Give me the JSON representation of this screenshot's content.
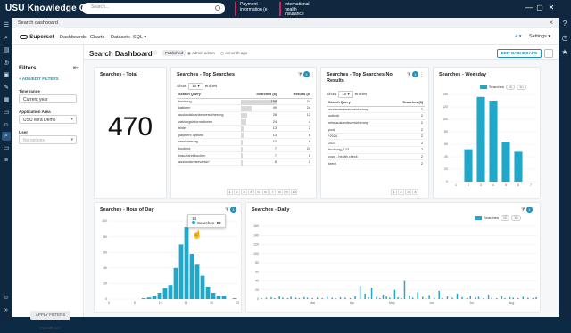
{
  "topbar": {
    "logo": "USU Knowledge Center",
    "search_placeholder": "Search...",
    "tabs": [
      {
        "label": "Payment information (e"
      },
      {
        "label": "International health insurance"
      }
    ]
  },
  "window": {
    "title": "Search dashboard"
  },
  "appnav": {
    "brand": "Superset",
    "items": [
      "Dashboards",
      "Charts",
      "Datasets",
      "SQL"
    ],
    "right_plus": "+",
    "settings": "Settings"
  },
  "dashboard": {
    "title": "Search Dashboard",
    "status": "Published",
    "author": "admin admin",
    "modified": "a month ago",
    "edit_label": "EDIT DASHBOARD",
    "more_label": "..."
  },
  "filters": {
    "heading": "Filters",
    "add_label": "+ ADD/EDIT FILTERS",
    "time_range_label": "Time range",
    "time_range_value": "Current year",
    "app_area_label": "Application Area",
    "app_area_value": "USU Mira Demo",
    "user_label": "User",
    "user_placeholder": "No options",
    "apply_label": "APPLY FILTERS",
    "clear_label": "CLEAR ALL"
  },
  "cards": {
    "total": {
      "title": "Searches - Total",
      "value": "470"
    },
    "top": {
      "title": "Searches - Top Searches",
      "show": "Show",
      "entries": "entries",
      "page_size": "10",
      "columns": [
        "Search Query",
        "Searches (8)",
        "Results (8)"
      ],
      "rows": [
        {
          "q": "buchung",
          "s": "158",
          "r": "24",
          "pct": 1.0
        },
        {
          "q": "kabinen",
          "s": "49",
          "r": "24",
          "pct": 0.31
        },
        {
          "q": "auslandskrankenversicherung",
          "s": "28",
          "r": "12",
          "pct": 0.18
        },
        {
          "q": "zahlungsinformationen",
          "s": "24",
          "r": "4",
          "pct": 0.15
        },
        {
          "q": "bilder",
          "s": "13",
          "r": "2",
          "pct": 0.08
        },
        {
          "q": "payment options",
          "s": "13",
          "r": "6",
          "pct": 0.08
        },
        {
          "q": "versicherung",
          "s": "10",
          "r": "8",
          "pct": 0.06
        },
        {
          "q": "booking",
          "s": "7",
          "r": "24",
          "pct": 0.045
        },
        {
          "q": "krauzfahrt buchen",
          "s": "7",
          "r": "8",
          "pct": 0.045
        },
        {
          "q": "auslandsreiseversic*",
          "s": "6",
          "r": "2",
          "pct": 0.04
        }
      ],
      "pages": [
        "1",
        "2",
        "3",
        "4",
        "5",
        "6",
        "7",
        "8",
        "9",
        "10"
      ]
    },
    "no_results": {
      "title": "Searches - Top Searches No Results",
      "show": "Show",
      "entries": "entries",
      "page_size": "10",
      "columns": [
        "Search Query",
        "Searches (8)"
      ],
      "rows": [
        {
          "q": "auslandsreiseversicherung",
          "s": "2"
        },
        {
          "q": "outlook",
          "s": "2"
        },
        {
          "q": "reiseauslandsversicherung",
          "s": "2"
        },
        {
          "q": "pool",
          "s": "2"
        },
        {
          "q": "*2024",
          "s": "2"
        },
        {
          "q": "2024",
          "s": "2"
        },
        {
          "q": "buchung_123",
          "s": "2"
        },
        {
          "q": "copy - health check",
          "s": "2"
        },
        {
          "q": "kerrd",
          "s": "2"
        }
      ],
      "pages": [
        "1",
        "2",
        "3",
        "4"
      ]
    },
    "weekday": {
      "title": "Searches - Weekday",
      "legend": "Searches",
      "pills": [
        "2D",
        "3D"
      ]
    },
    "hour": {
      "title": "Searches - Hour of Day",
      "tooltip_title": "14",
      "tooltip_series": "Searches",
      "tooltip_value": "92"
    },
    "daily": {
      "title": "Searches - Daily",
      "legend": "Searches",
      "pills": [
        "2D",
        "3D"
      ]
    }
  },
  "chart_data": [
    {
      "type": "bar",
      "title": "Searches - Weekday",
      "categories": [
        "1",
        "2",
        "3",
        "4",
        "5",
        "6",
        "7"
      ],
      "series": [
        {
          "name": "Searches",
          "values": [
            0,
            52,
            136,
            130,
            64,
            48,
            0
          ]
        }
      ],
      "ylim": [
        0,
        140
      ],
      "yticks": [
        0,
        20,
        40,
        60,
        80,
        100,
        120,
        140
      ]
    },
    {
      "type": "bar",
      "title": "Searches - Hour of Day",
      "categories": [
        "0",
        "1",
        "2",
        "3",
        "4",
        "5",
        "6",
        "7",
        "8",
        "9",
        "10",
        "11",
        "12",
        "13",
        "14",
        "15",
        "16",
        "17",
        "18",
        "19",
        "20",
        "21",
        "22",
        "23"
      ],
      "series": [
        {
          "name": "Searches",
          "values": [
            0,
            0,
            0,
            0,
            0,
            0,
            1,
            2,
            4,
            8,
            14,
            18,
            40,
            70,
            92,
            58,
            44,
            30,
            16,
            8,
            4,
            4,
            0,
            1
          ]
        }
      ],
      "ylim": [
        0,
        100
      ],
      "yticks": [
        0,
        20,
        40,
        60,
        80,
        100
      ],
      "xticks": [
        "0",
        "5",
        "10",
        "15",
        "20",
        "23"
      ]
    },
    {
      "type": "bar",
      "title": "Searches - Daily",
      "series": [
        {
          "name": "Searches",
          "values": [
            2,
            0,
            0,
            3,
            0,
            0,
            4,
            0,
            2,
            0,
            0,
            6,
            0,
            3,
            0,
            0,
            2,
            0,
            5,
            0,
            0,
            3,
            0,
            2,
            0,
            0,
            4,
            0,
            3,
            0,
            0,
            2,
            0,
            0,
            3,
            0,
            0,
            2,
            0,
            0,
            5,
            0,
            0,
            3,
            0,
            2,
            0,
            0,
            4,
            0,
            0,
            3,
            0,
            0,
            2,
            0,
            0,
            6,
            0,
            0,
            30,
            0,
            0,
            12,
            0,
            4,
            0,
            25,
            0,
            0,
            5,
            0,
            2,
            0,
            10,
            0,
            6,
            0,
            3,
            0,
            0,
            20,
            0,
            4,
            0,
            2,
            0,
            40,
            0,
            0,
            8,
            0,
            3,
            0,
            0,
            15,
            0,
            0,
            5,
            0,
            2,
            0,
            9,
            0,
            0,
            3,
            0,
            0,
            18,
            0,
            2,
            0,
            0,
            6,
            0,
            0,
            3,
            0,
            0,
            12,
            0,
            0,
            4,
            0,
            0,
            2,
            0,
            7,
            0,
            0,
            3,
            0,
            5,
            0,
            0,
            2,
            0,
            0,
            10,
            0,
            3,
            0,
            0,
            2,
            0,
            0,
            6,
            0,
            2,
            0,
            0,
            4,
            0,
            3,
            0,
            0,
            2,
            0,
            0,
            5,
            0,
            0,
            3,
            0,
            0,
            2,
            0,
            4
          ]
        }
      ],
      "ylim": [
        0,
        160
      ],
      "yticks": [
        0,
        20,
        40,
        60,
        80,
        100,
        120,
        140,
        160
      ],
      "xticks": [
        "Mar",
        "Apr",
        "May",
        "Jun",
        "Jul",
        "Aug"
      ]
    }
  ],
  "colors": {
    "bar": "#1fa8c9",
    "accent": "#1e8fb5",
    "badge": "#1e8fb5"
  }
}
